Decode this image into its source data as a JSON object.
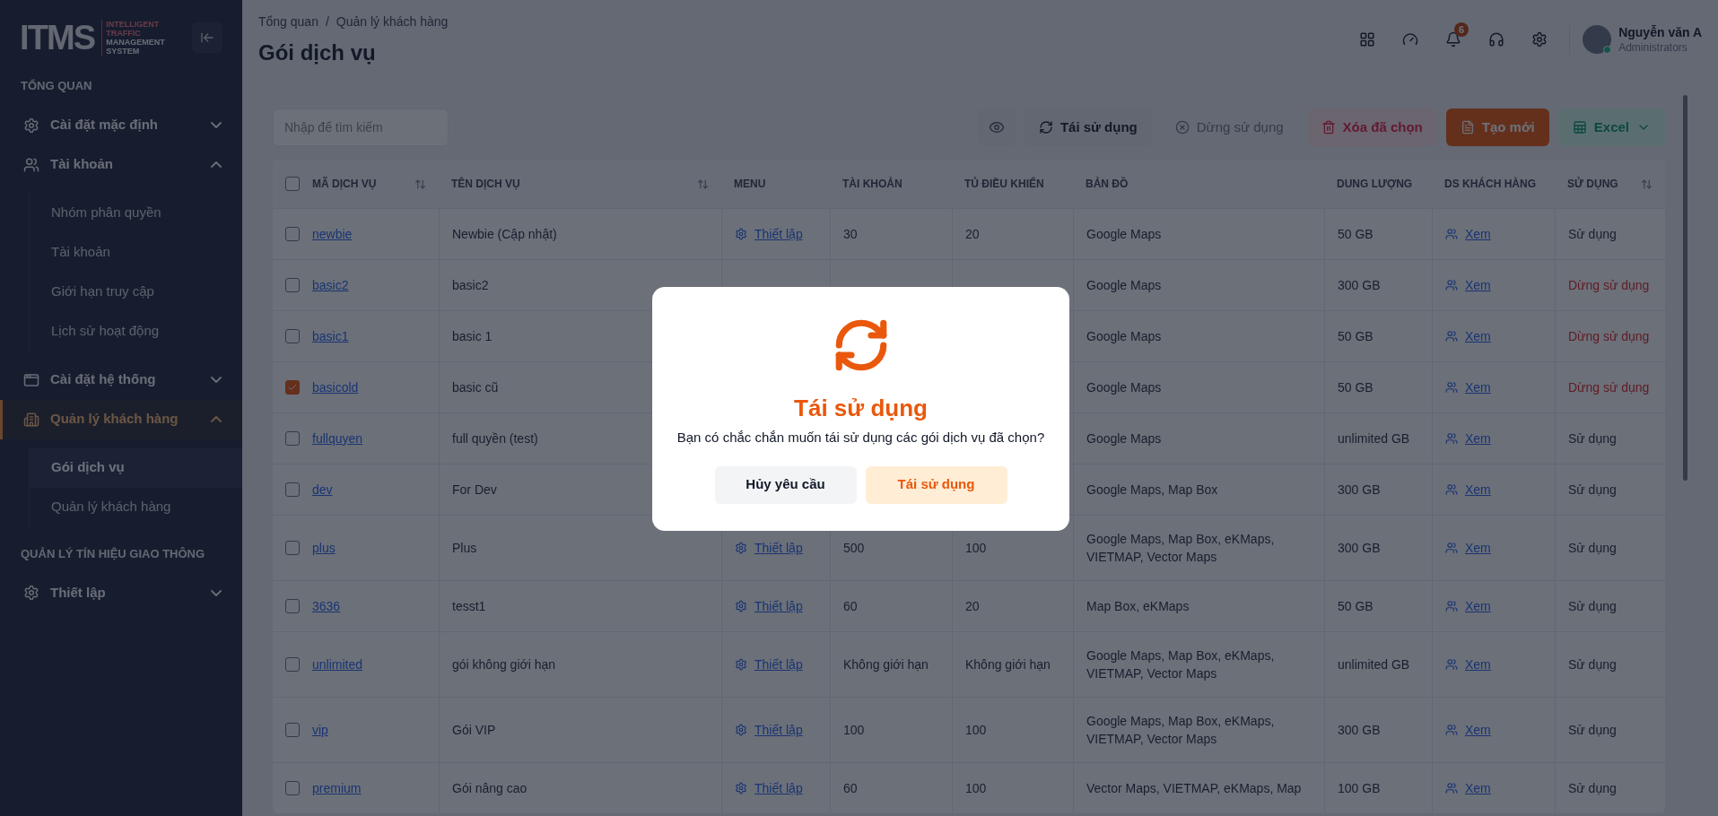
{
  "sidebar": {
    "logo": {
      "mark": "ITMS",
      "tagline": [
        "INTELLIGENT",
        "TRAFFIC",
        "MANAGEMENT",
        "SYSTEM"
      ]
    },
    "sections": [
      {
        "title": "TỔNG QUAN",
        "groups": [
          {
            "label": "Cài đặt mặc định",
            "kind": "gear",
            "expanded": false,
            "selected": false
          },
          {
            "label": "Tài khoản",
            "kind": "users",
            "expanded": true,
            "selected": false,
            "children": [
              {
                "label": "Nhóm phân quyền",
                "selected": false
              },
              {
                "label": "Tài khoản",
                "selected": false
              },
              {
                "label": "Giới hạn truy cập",
                "selected": false
              },
              {
                "label": "Lịch sử hoạt động",
                "selected": false
              }
            ]
          },
          {
            "label": "Cài đặt hệ thống",
            "kind": "window",
            "expanded": false,
            "selected": false
          },
          {
            "label": "Quản lý khách hàng",
            "kind": "building",
            "expanded": true,
            "selected": true,
            "children": [
              {
                "label": "Gói dịch vụ",
                "selected": true
              },
              {
                "label": "Quản lý khách hàng",
                "selected": false
              }
            ]
          }
        ]
      },
      {
        "title": "QUẢN LÝ TÍN HIỆU GIAO THÔNG",
        "groups": [
          {
            "label": "Thiết lập",
            "kind": "gear",
            "expanded": false,
            "selected": false
          }
        ]
      }
    ]
  },
  "header": {
    "breadcrumb": [
      "Tổng quan",
      "Quản lý khách hàng"
    ],
    "breadcrumb_separator": "/",
    "title": "Gói dịch vụ",
    "notification_count": "6",
    "user": {
      "name": "Nguyễn văn A",
      "role": "Administrators",
      "online": true
    }
  },
  "toolbar": {
    "search": {
      "placeholder": "Nhập để tìm kiếm"
    },
    "buttons": [
      {
        "kind": "view"
      },
      {
        "kind": "reuse",
        "label": "Tái sử dụng"
      },
      {
        "kind": "stop",
        "label": "Dừng sử dụng"
      },
      {
        "kind": "delete",
        "label": "Xóa đã chọn"
      },
      {
        "kind": "create",
        "label": "Tạo mới"
      },
      {
        "kind": "excel",
        "label": "Excel"
      }
    ]
  },
  "table": {
    "all_checked": false,
    "columns": [
      {
        "label": "MÃ DỊCH VỤ",
        "sortable": true
      },
      {
        "label": "TÊN DỊCH VỤ",
        "sortable": true
      },
      {
        "label": "MENU",
        "sortable": false
      },
      {
        "label": "TÀI KHOẢN",
        "sortable": false
      },
      {
        "label": "TỦ ĐIỀU KHIỂN",
        "sortable": false
      },
      {
        "label": "BẢN ĐỒ",
        "sortable": false
      },
      {
        "label": "DUNG LƯỢNG",
        "sortable": false
      },
      {
        "label": "DS KHÁCH HÀNG",
        "sortable": false
      },
      {
        "label": "SỬ DỤNG",
        "sortable": true
      }
    ],
    "rows": [
      {
        "checked": false,
        "code": "newbie",
        "name": "Newbie (Cập nhật)",
        "menu": "Thiết lập",
        "accounts": "30",
        "controllers": "20",
        "maps": [
          "Google Maps"
        ],
        "storage": "50 GB",
        "customers": "Xem",
        "status": "Sử dụng",
        "stopped": false
      },
      {
        "checked": false,
        "code": "basic2",
        "name": "basic2",
        "maps": [
          "Google Maps"
        ],
        "storage": "300 GB",
        "customers": "Xem",
        "status": "Dừng sử dụng",
        "stopped": true
      },
      {
        "checked": false,
        "code": "basic1",
        "name": "basic 1",
        "maps": [
          "Google Maps"
        ],
        "storage": "50 GB",
        "customers": "Xem",
        "status": "Dừng sử dụng",
        "stopped": true
      },
      {
        "checked": true,
        "code": "basicold",
        "name": "basic cũ",
        "maps": [
          "Google Maps"
        ],
        "storage": "50 GB",
        "customers": "Xem",
        "status": "Dừng sử dụng",
        "stopped": true
      },
      {
        "checked": false,
        "code": "fullquyen",
        "name": "full quyền (test)",
        "maps": [
          "Google Maps"
        ],
        "storage": "unlimited GB",
        "customers": "Xem",
        "status": "Sử dụng",
        "stopped": false
      },
      {
        "checked": false,
        "code": "dev",
        "name": "For Dev",
        "maps": [
          "Google Maps, Map Box"
        ],
        "storage": "300 GB",
        "customers": "Xem",
        "status": "Sử dụng",
        "stopped": false
      },
      {
        "checked": false,
        "code": "plus",
        "name": "Plus",
        "menu": "Thiết lập",
        "accounts": "500",
        "controllers": "100",
        "maps": [
          "Google Maps, Map Box, eKMaps,",
          "VIETMAP, Vector Maps"
        ],
        "storage": "300 GB",
        "customers": "Xem",
        "status": "Sử dụng",
        "stopped": false
      },
      {
        "checked": false,
        "code": "3636",
        "name": "tesst1",
        "menu": "Thiết lập",
        "accounts": "60",
        "controllers": "20",
        "maps": [
          "Map Box, eKMaps"
        ],
        "storage": "50 GB",
        "customers": "Xem",
        "status": "Sử dụng",
        "stopped": false
      },
      {
        "checked": false,
        "code": "unlimited",
        "name": "gói không giới hạn",
        "menu": "Thiết lập",
        "accounts": "Không giới hạn",
        "controllers": "Không giới hạn",
        "maps": [
          "Google Maps, Map Box, eKMaps,",
          "VIETMAP, Vector Maps"
        ],
        "storage": "unlimited GB",
        "customers": "Xem",
        "status": "Sử dụng",
        "stopped": false
      },
      {
        "checked": false,
        "code": "vip",
        "name": "Gói VIP",
        "menu": "Thiết lập",
        "accounts": "100",
        "controllers": "100",
        "maps": [
          "Google Maps, Map Box, eKMaps,",
          "VIETMAP, Vector Maps"
        ],
        "storage": "300 GB",
        "customers": "Xem",
        "status": "Sử dụng",
        "stopped": false
      },
      {
        "checked": false,
        "code": "premium",
        "name": "Gói nâng cao",
        "menu": "Thiết lập",
        "accounts": "60",
        "controllers": "100",
        "maps": [
          "Vector Maps, VIETMAP, eKMaps, Map"
        ],
        "storage": "100 GB",
        "customers": "Xem",
        "status": "Sử dụng",
        "stopped": false
      }
    ]
  },
  "dialog": {
    "open": true,
    "title": "Tái sử dụng",
    "message": "Bạn có chắc chắn muốn tái sử dụng các gói dịch vụ đã chọn?",
    "buttons": [
      {
        "kind": "cancel",
        "label": "Hủy yêu cầu"
      },
      {
        "kind": "confirm",
        "label": "Tái sử dụng"
      }
    ]
  }
}
